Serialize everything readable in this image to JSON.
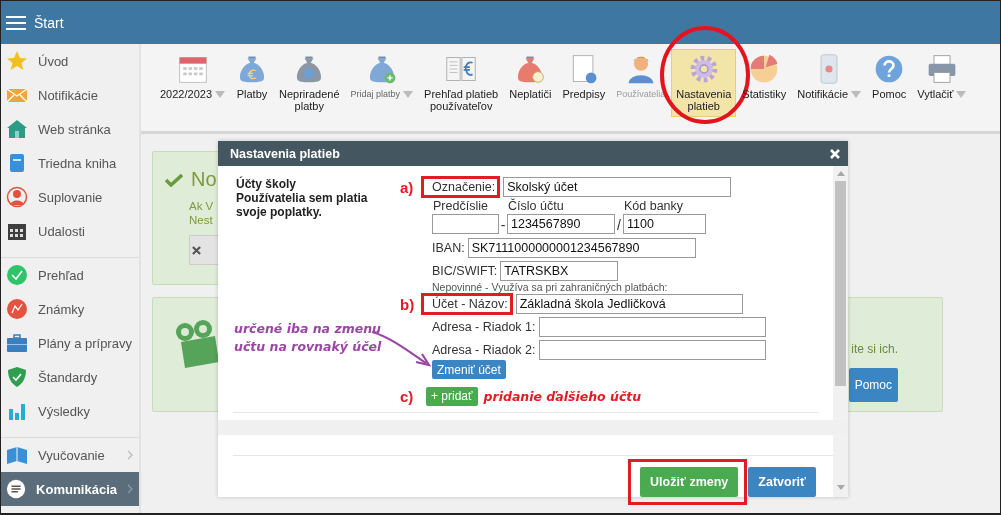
{
  "top_bar": {
    "title": "Štart"
  },
  "sidebar": {
    "groups": [
      {
        "items": [
          {
            "label": "Úvod",
            "selected": false,
            "expandable": false
          },
          {
            "label": "Notifikácie",
            "selected": false,
            "expandable": false
          },
          {
            "label": "Web stránka",
            "selected": false,
            "expandable": false
          },
          {
            "label": "Triedna kniha",
            "selected": false,
            "expandable": false
          },
          {
            "label": "Suplovanie",
            "selected": false,
            "expandable": false
          },
          {
            "label": "Udalosti",
            "selected": false,
            "expandable": false
          }
        ]
      },
      {
        "items": [
          {
            "label": "Prehľad",
            "selected": false,
            "expandable": false
          },
          {
            "label": "Známky",
            "selected": false,
            "expandable": false
          },
          {
            "label": "Plány a prípravy",
            "selected": false,
            "expandable": false
          },
          {
            "label": "Štandardy",
            "selected": false,
            "expandable": false
          },
          {
            "label": "Výsledky",
            "selected": false,
            "expandable": false
          }
        ]
      },
      {
        "items": [
          {
            "label": "Vyučovanie",
            "selected": false,
            "expandable": true
          },
          {
            "label": "Komunikácia",
            "selected": true,
            "expandable": true
          }
        ]
      }
    ]
  },
  "toolbar": {
    "items": [
      {
        "label": "2022/2023",
        "selected": false,
        "dropdown": true,
        "compact": false,
        "disabled": false,
        "circled": false
      },
      {
        "label": "Platby",
        "selected": false,
        "dropdown": false,
        "compact": false,
        "disabled": false,
        "circled": false
      },
      {
        "label": "Nepriradené\nplatby",
        "selected": false,
        "dropdown": false,
        "compact": false,
        "disabled": false,
        "circled": false
      },
      {
        "label": "Pridaj platby",
        "selected": false,
        "dropdown": true,
        "compact": true,
        "disabled": false,
        "circled": false
      },
      {
        "label": "Prehľad platieb\npoužívateľov",
        "selected": false,
        "dropdown": false,
        "compact": false,
        "disabled": false,
        "circled": false
      },
      {
        "label": "Neplatiči",
        "selected": false,
        "dropdown": false,
        "compact": false,
        "disabled": false,
        "circled": false
      },
      {
        "label": "Predpisy",
        "selected": false,
        "dropdown": false,
        "compact": false,
        "disabled": false,
        "circled": false
      },
      {
        "label": "Používatelia",
        "selected": false,
        "dropdown": false,
        "compact": true,
        "disabled": true,
        "circled": false
      },
      {
        "label": "Nastavenia\nplatieb",
        "selected": true,
        "dropdown": false,
        "compact": false,
        "disabled": false,
        "circled": true
      },
      {
        "label": "Statistiky",
        "selected": false,
        "dropdown": false,
        "compact": false,
        "disabled": false,
        "circled": false
      },
      {
        "label": "Notifikácie",
        "selected": false,
        "dropdown": true,
        "compact": false,
        "disabled": false,
        "circled": false
      },
      {
        "label": "Pomoc",
        "selected": false,
        "dropdown": false,
        "compact": false,
        "disabled": false,
        "circled": false
      },
      {
        "label": "Vytlačiť",
        "selected": false,
        "dropdown": true,
        "compact": false,
        "disabled": false,
        "circled": false
      }
    ]
  },
  "notice": {
    "heading": "No",
    "lines": [
      "Ak V",
      "Nest"
    ]
  },
  "info_panel": {
    "text": "ite si ich.",
    "button": "Pomoc"
  },
  "dialog": {
    "title": "Nastavenia platieb",
    "section_title": "Účty školy",
    "section_note": "Používatelia sem platia svoje poplatky.",
    "name_field": {
      "mark": "a)",
      "label": "Označenie:",
      "value": "Skolský účet",
      "highlighted": true
    },
    "account": [
      {
        "label": "Predčíslie"
      },
      {
        "label": "Číslo účtu",
        "value": "1234567890",
        "separator": "-"
      },
      {
        "label": "Kód banky",
        "value": "1100",
        "separator": "/"
      }
    ],
    "iban": {
      "label": "IBAN:",
      "value": "SK7111000000001234567890"
    },
    "bic": {
      "label": "BIC/SWIFT:",
      "value": "TATRSKBX"
    },
    "optional_note": "Nepovinné - Využíva sa pri zahraničných platbách:",
    "account_name": {
      "mark": "b)",
      "label": "Účet - Názov:",
      "value": "Základná škola Jedličková",
      "highlighted": true
    },
    "address_lines": [
      {
        "label": "Adresa - Riadok 1:"
      },
      {
        "label": "Adresa - Riadok 2:"
      }
    ],
    "change_button": "Zmeniť účet",
    "add_mark": "c)",
    "add_button": "+ pridať",
    "add_note": "pridanie ďalšieho účtu",
    "side_note": "určené iba na zmenu\nučtu na rovnaký účel",
    "footer_buttons": [
      {
        "label": "Uložiť zmeny",
        "kind": "primary",
        "highlighted": true
      },
      {
        "label": "Zatvoriť",
        "kind": "secondary",
        "highlighted": false
      }
    ]
  }
}
